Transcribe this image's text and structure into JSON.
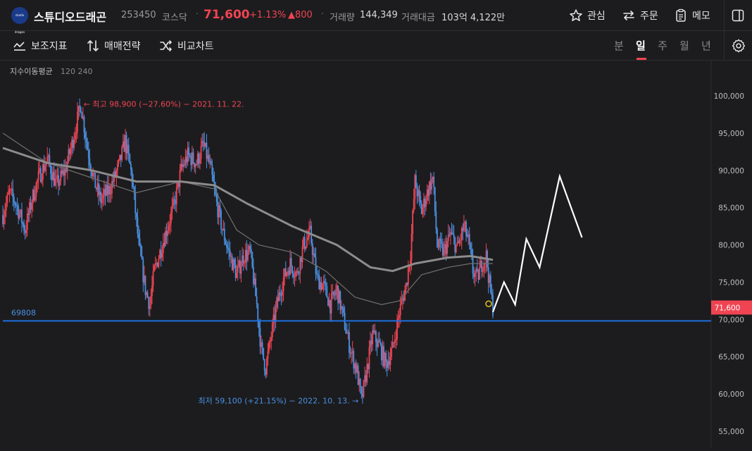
{
  "header": {
    "logo_text": "studio dragon",
    "name": "스튜디오드래곤",
    "code": "253450",
    "market": "코스닥",
    "price": "71,600",
    "change_pct": "+1.13%",
    "change_abs": "▲800",
    "volume_label": "거래량",
    "volume_value": "144,349",
    "amount_label": "거래대금",
    "amount_value": "103억 4,122만",
    "buttons": {
      "watch": "관심",
      "order": "주문",
      "memo": "메모"
    }
  },
  "toolbar": {
    "indicators": "보조지표",
    "strategy": "매매전략",
    "compare": "비교차트",
    "periods": [
      "분",
      "일",
      "주",
      "월",
      "년"
    ],
    "active_period": "일"
  },
  "colors": {
    "up": "#f04452",
    "down": "#4a90e2",
    "support_line": "#1e6fe0",
    "ma_thick": "#8c8c8c",
    "ma_thin": "#6f6f6f",
    "projection": "#ffffff",
    "marker": "#e0c020"
  },
  "chart_data": {
    "type": "candlestick",
    "legend": {
      "label": "지수이동평균",
      "periods": "120 240"
    },
    "ylim": [
      53000,
      104000
    ],
    "y_ticks": [
      "100,000",
      "95,000",
      "90,000",
      "85,000",
      "80,000",
      "75,000",
      "70,000",
      "65,000",
      "60,000",
      "55,000"
    ],
    "y_tick_values": [
      100000,
      95000,
      90000,
      85000,
      80000,
      75000,
      70000,
      65000,
      60000,
      55000
    ],
    "x_index_range": [
      0,
      220
    ],
    "current_price": {
      "label": "71,600",
      "value": 71600
    },
    "support": {
      "label": "69808",
      "value": 69808
    },
    "high": {
      "label": "← 최고 98,900 (−27.60%) − 2021. 11. 22.",
      "value": 98900,
      "index": 35
    },
    "low": {
      "label": "최저 59,100 (+21.15%) − 2022. 10. 13. →",
      "value": 59100,
      "index": 161
    },
    "price_path": [
      [
        0,
        84000
      ],
      [
        3,
        87000
      ],
      [
        6,
        85500
      ],
      [
        10,
        82000
      ],
      [
        13,
        86000
      ],
      [
        16,
        89000
      ],
      [
        20,
        91500
      ],
      [
        24,
        88000
      ],
      [
        28,
        90000
      ],
      [
        31,
        93500
      ],
      [
        35,
        98900
      ],
      [
        38,
        93000
      ],
      [
        41,
        88500
      ],
      [
        44,
        86000
      ],
      [
        48,
        87500
      ],
      [
        52,
        90500
      ],
      [
        55,
        94000
      ],
      [
        58,
        89000
      ],
      [
        61,
        80000
      ],
      [
        64,
        74000
      ],
      [
        66,
        72000
      ],
      [
        68,
        76500
      ],
      [
        71,
        79500
      ],
      [
        74,
        82500
      ],
      [
        77,
        85500
      ],
      [
        80,
        90000
      ],
      [
        83,
        92000
      ],
      [
        87,
        91000
      ],
      [
        90,
        93500
      ],
      [
        93,
        90500
      ],
      [
        96,
        85500
      ],
      [
        99,
        81500
      ],
      [
        102,
        78500
      ],
      [
        105,
        76000
      ],
      [
        108,
        78500
      ],
      [
        111,
        79000
      ],
      [
        114,
        72000
      ],
      [
        116,
        66000
      ],
      [
        118,
        63500
      ],
      [
        120,
        67000
      ],
      [
        123,
        72000
      ],
      [
        126,
        75500
      ],
      [
        129,
        77500
      ],
      [
        132,
        76000
      ],
      [
        135,
        80000
      ],
      [
        138,
        81500
      ],
      [
        141,
        75500
      ],
      [
        144,
        74500
      ],
      [
        147,
        72000
      ],
      [
        150,
        74000
      ],
      [
        153,
        70000
      ],
      [
        156,
        66000
      ],
      [
        159,
        63000
      ],
      [
        161,
        59100
      ],
      [
        163,
        62500
      ],
      [
        166,
        68000
      ],
      [
        169,
        66500
      ],
      [
        172,
        64000
      ],
      [
        175,
        66000
      ],
      [
        178,
        71000
      ],
      [
        181,
        74500
      ],
      [
        183,
        79000
      ],
      [
        185,
        88500
      ],
      [
        188,
        84500
      ],
      [
        191,
        87500
      ],
      [
        193,
        89000
      ],
      [
        195,
        80000
      ],
      [
        198,
        79000
      ],
      [
        201,
        81500
      ],
      [
        204,
        79500
      ],
      [
        207,
        82500
      ],
      [
        209,
        80500
      ],
      [
        211,
        76500
      ],
      [
        213,
        75500
      ],
      [
        215,
        77500
      ],
      [
        217,
        78500
      ],
      [
        219,
        73500
      ],
      [
        220,
        71600
      ]
    ],
    "ema_120": [
      [
        0,
        93000
      ],
      [
        20,
        91000
      ],
      [
        40,
        90000
      ],
      [
        60,
        88500
      ],
      [
        80,
        88500
      ],
      [
        95,
        88000
      ],
      [
        110,
        85500
      ],
      [
        130,
        82500
      ],
      [
        150,
        80000
      ],
      [
        165,
        77000
      ],
      [
        175,
        76500
      ],
      [
        185,
        77500
      ],
      [
        200,
        78300
      ],
      [
        210,
        78500
      ],
      [
        220,
        78000
      ]
    ],
    "ema_240": [
      [
        0,
        95000
      ],
      [
        20,
        91000
      ],
      [
        40,
        89000
      ],
      [
        60,
        87000
      ],
      [
        80,
        88500
      ],
      [
        95,
        87500
      ],
      [
        105,
        82000
      ],
      [
        115,
        80000
      ],
      [
        130,
        79000
      ],
      [
        145,
        76500
      ],
      [
        158,
        73000
      ],
      [
        170,
        72000
      ],
      [
        178,
        72500
      ],
      [
        188,
        76000
      ],
      [
        200,
        77000
      ],
      [
        210,
        77500
      ],
      [
        220,
        77500
      ]
    ],
    "projection_path": [
      [
        220,
        71000
      ],
      [
        225,
        75000
      ],
      [
        230,
        72000
      ],
      [
        235,
        80800
      ],
      [
        241,
        77000
      ],
      [
        250,
        89200
      ],
      [
        260,
        81000
      ]
    ]
  }
}
